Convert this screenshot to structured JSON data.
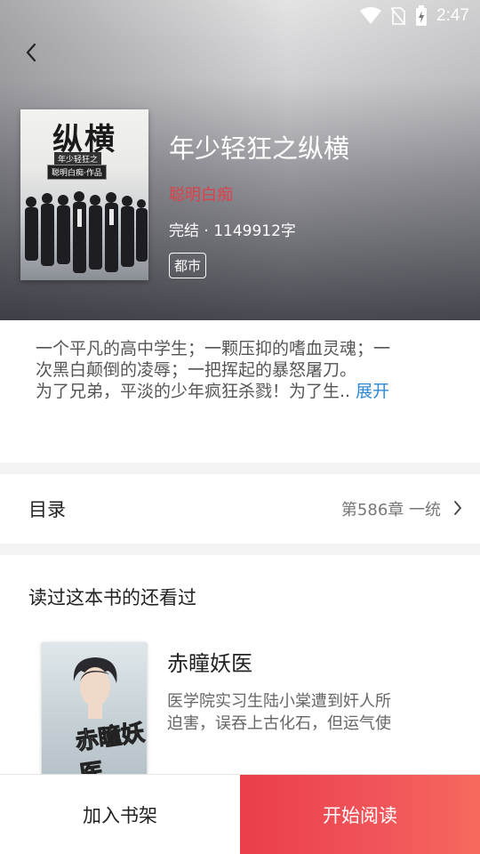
{
  "status_bar": {
    "time": "2:47"
  },
  "book": {
    "title": "年少轻狂之纵横",
    "author": "聪明白痴",
    "meta": "完结 · 1149912字",
    "tag": "都市",
    "cover": {
      "title": "纵横",
      "subtitle": "年少轻狂之",
      "author_line": "聪明白痴·作品"
    },
    "description_lines": [
      "一个平凡的高中学生；一颗压抑的嗜血灵魂；一",
      "次黑白颠倒的凌辱；一把挥起的暴怒屠刀。",
      "为了兄弟，平淡的少年疯狂杀戮！为了生.."
    ],
    "expand_label": "展开"
  },
  "toc": {
    "label": "目录",
    "latest_chapter": "第586章 一统"
  },
  "recommend": {
    "section_title": "读过这本书的还看过",
    "items": [
      {
        "title": "赤瞳妖医",
        "cover_title": "赤瞳妖医",
        "description_lines": [
          "医学院实习生陆小棠遭到奸人所",
          "迫害，误吞上古化石，但运气使"
        ]
      }
    ]
  },
  "actions": {
    "add_shelf": "加入书架",
    "start_read": "开始阅读"
  },
  "colors": {
    "accent_red": "#ea3e4a",
    "author_red": "#e0404a",
    "link_blue": "#2e8ad6"
  }
}
